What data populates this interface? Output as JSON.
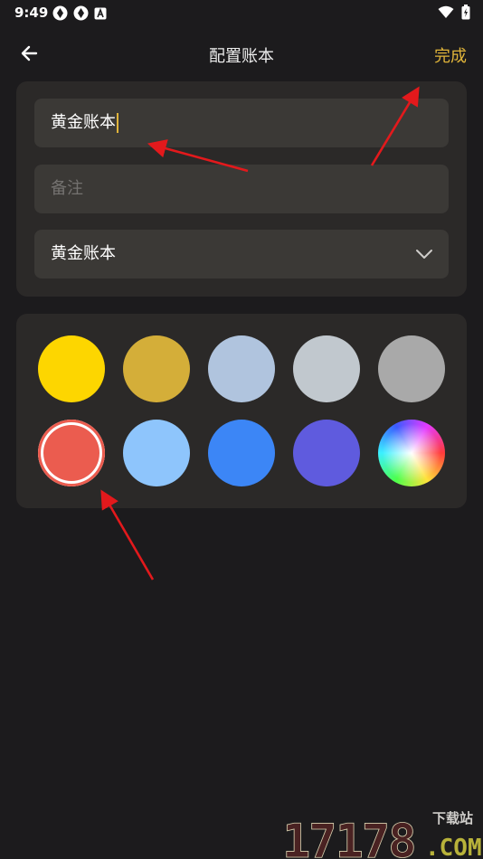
{
  "status_bar": {
    "time": "9:49",
    "left_icons": [
      "notification-app-icon",
      "notification-app-icon",
      "notification-a-icon"
    ],
    "right_icons": [
      "wifi-icon",
      "battery-icon"
    ]
  },
  "app_bar": {
    "back_icon": "arrow-left-icon",
    "title": "配置账本",
    "done_label": "完成"
  },
  "form": {
    "name_value": "黄金账本",
    "note_placeholder": "备注",
    "note_value": "",
    "book_select_value": "黄金账本",
    "select_icon": "chevron-down-icon"
  },
  "colors": {
    "selected_index": 5,
    "swatches": [
      {
        "name": "yellow",
        "color": "#fdd600"
      },
      {
        "name": "gold",
        "color": "#d4ae39"
      },
      {
        "name": "light-steel-blue",
        "color": "#b0c4de"
      },
      {
        "name": "silver",
        "color": "#c1c8ce"
      },
      {
        "name": "gray",
        "color": "#a9a9a9"
      },
      {
        "name": "red",
        "color": "#eb5c4f"
      },
      {
        "name": "light-sky-blue",
        "color": "#8ec5fc"
      },
      {
        "name": "blue",
        "color": "#3c86f6"
      },
      {
        "name": "indigo",
        "color": "#5f5bde"
      },
      {
        "name": "custom",
        "color": "rainbow"
      }
    ]
  },
  "annotations": {
    "arrow_color": "#e3191c"
  },
  "watermark": {
    "number": "17178",
    "sub": "下载站",
    "domain": ".COM"
  },
  "theme": {
    "background": "#1c1b1d",
    "card": "#2b2928",
    "field": "#3b3936",
    "accent": "#e0b43a"
  }
}
